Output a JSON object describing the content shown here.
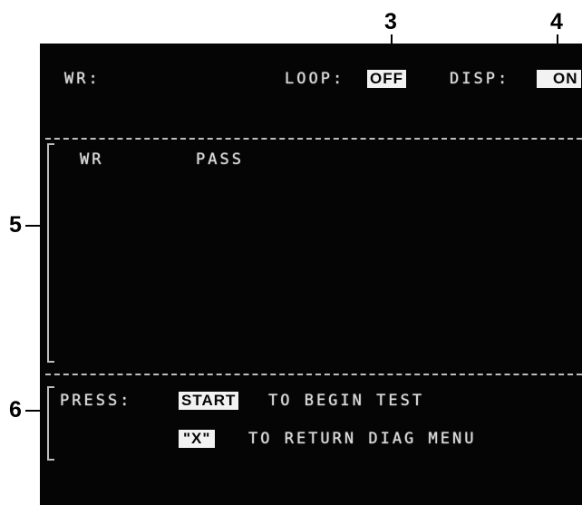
{
  "callouts": {
    "c3": "3",
    "c4": "4",
    "c5": "5",
    "c6": "6"
  },
  "header": {
    "wr_label": "WR:",
    "loop_label": "LOOP:",
    "loop_value": "OFF",
    "disp_label": "DISP:",
    "disp_value": "ON"
  },
  "results": {
    "col_wr": "WR",
    "col_pass": "PASS"
  },
  "prompt": {
    "press_label": "PRESS:",
    "start_key": "START",
    "start_text": "TO BEGIN TEST",
    "x_key": "\"X\"",
    "x_text": "TO RETURN DIAG MENU"
  }
}
